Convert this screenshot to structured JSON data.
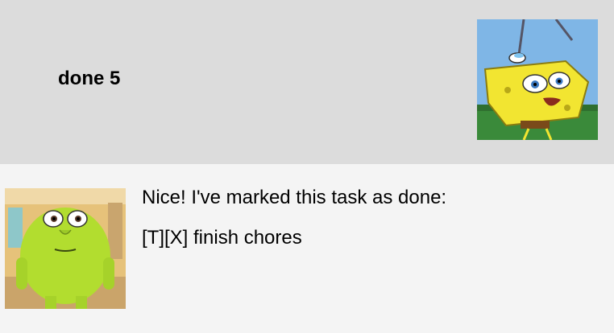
{
  "user_message": {
    "text": "done 5",
    "avatar_icon": "sponge-cartoon-avatar"
  },
  "bot_message": {
    "lines": [
      "Nice! I've marked this task as done:",
      "[T][X] finish chores"
    ],
    "avatar_icon": "green-monster-avatar"
  },
  "colors": {
    "user_row_bg": "#dcdcdc",
    "bot_row_bg": "#f4f4f4",
    "text": "#000000"
  }
}
